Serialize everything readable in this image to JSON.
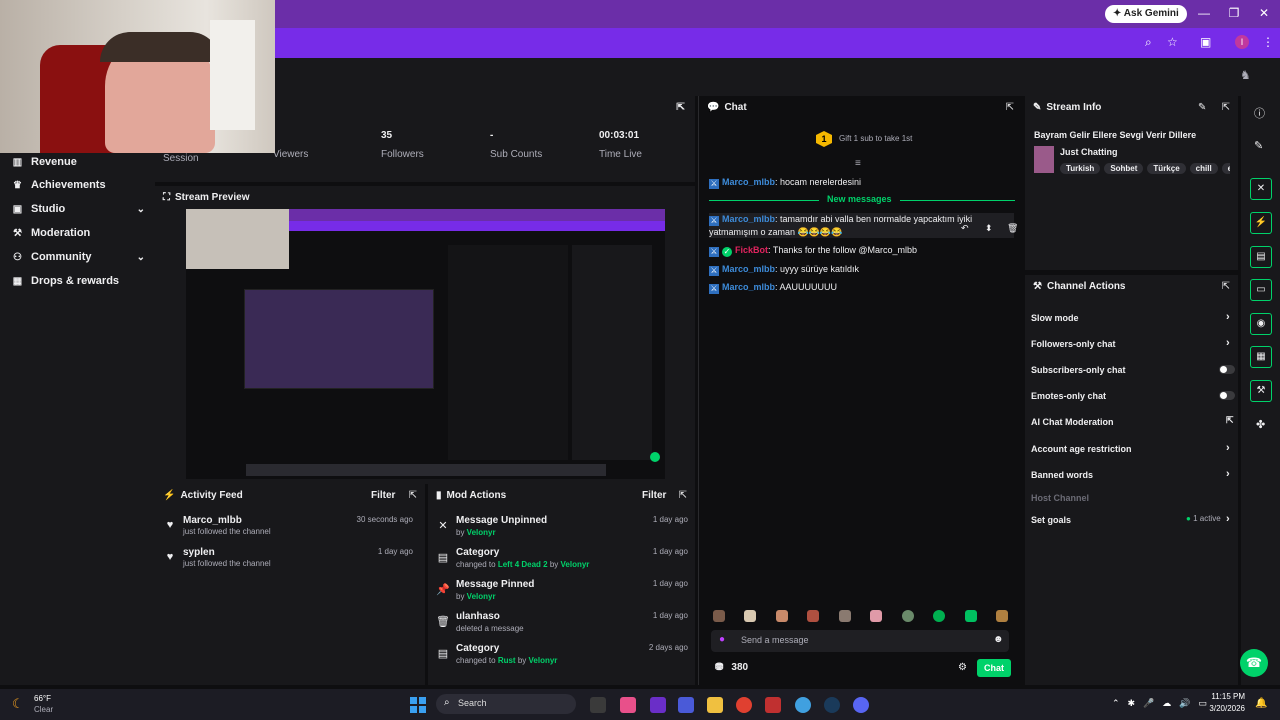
{
  "browser": {
    "gemini_label": "Ask Gemini",
    "profile_initial": "I"
  },
  "sidebar": {
    "items": [
      {
        "label": "Revenue",
        "icon": "bar-chart-icon",
        "glyph": "▥",
        "chevron": false
      },
      {
        "label": "Achievements",
        "icon": "trophy-icon",
        "glyph": "🏆",
        "chevron": false
      },
      {
        "label": "Studio",
        "icon": "studio-icon",
        "glyph": "▣",
        "chevron": true
      },
      {
        "label": "Moderation",
        "icon": "wrench-icon",
        "glyph": "🔧",
        "chevron": false
      },
      {
        "label": "Community",
        "icon": "community-icon",
        "glyph": "👥",
        "chevron": true
      },
      {
        "label": "Drops & rewards",
        "icon": "gift-icon",
        "glyph": "🎁",
        "chevron": false
      }
    ]
  },
  "stats": [
    {
      "value": "",
      "label": "Session"
    },
    {
      "value": "",
      "label": "Viewers"
    },
    {
      "value": "35",
      "label": "Followers"
    },
    {
      "value": "-",
      "label": "Sub Counts"
    },
    {
      "value": "00:03:01",
      "label": "Time Live"
    }
  ],
  "stream_preview": {
    "title": "Stream Preview"
  },
  "activity_feed": {
    "title": "Activity Feed",
    "filter_label": "Filter",
    "items": [
      {
        "name": "Marco_mlbb",
        "action": "just followed the channel",
        "time": "30 seconds ago"
      },
      {
        "name": "syplen",
        "action": "just followed the channel",
        "time": "1 day ago"
      }
    ]
  },
  "mod_actions": {
    "title": "Mod Actions",
    "filter_label": "Filter",
    "items": [
      {
        "icon": "unpin-icon",
        "glyph": "✕",
        "name": "Message Unpinned",
        "pre": "by ",
        "hl": "Velonyr",
        "mid": "",
        "hl2": "",
        "time": "1 day ago"
      },
      {
        "icon": "category-icon",
        "glyph": "▤",
        "name": "Category",
        "pre": "changed to ",
        "hl": "Left 4 Dead 2",
        "mid": " by ",
        "hl2": "Velonyr",
        "time": "1 day ago"
      },
      {
        "icon": "pin-icon",
        "glyph": "📌",
        "name": "Message Pinned",
        "pre": "by ",
        "hl": "Velonyr",
        "mid": "",
        "hl2": "",
        "time": "1 day ago"
      },
      {
        "icon": "trash-icon",
        "glyph": "🗑",
        "name": "ulanhaso",
        "pre": "deleted a message",
        "hl": "",
        "mid": "",
        "hl2": "",
        "time": "1 day ago"
      },
      {
        "icon": "category-icon",
        "glyph": "▤",
        "name": "Category",
        "pre": "changed to ",
        "hl": "Rust",
        "mid": " by ",
        "hl2": "Velonyr",
        "time": "2 days ago"
      }
    ]
  },
  "chat": {
    "title": "Chat",
    "gift_label": "Gift 1 sub to take 1st",
    "gift_rank": "1",
    "new_messages_label": "New messages",
    "messages": [
      {
        "user": "Marco_mlbb",
        "color": "#3d8bd9",
        "text": ": hocam nerelerdesini"
      },
      {
        "user": "Marco_mlbb",
        "color": "#3d8bd9",
        "text": ": tamamdır abi valla ben normalde yapcaktım iyiki yatmamışım o zaman 😂😂😂😂"
      },
      {
        "user": "FickBot",
        "color": "#e0245e",
        "text": ": Thanks for the follow @Marco_mlbb"
      },
      {
        "user": "Marco_mlbb",
        "color": "#3d8bd9",
        "text": ": uyyy sürüye katıldık"
      },
      {
        "user": "Marco_mlbb",
        "color": "#3d8bd9",
        "text": ": AAUUUUUUU"
      }
    ],
    "input_placeholder": "Send a message",
    "points": "380",
    "chat_button": "Chat"
  },
  "stream_info": {
    "title": "Stream Info",
    "stream_title": "Bayram Gelir Ellere Sevgi Verir Dillere",
    "category": "Just Chatting",
    "tags": [
      "Turkish",
      "Sohbet",
      "Türkçe",
      "chill",
      "el"
    ]
  },
  "channel_actions": {
    "title": "Channel Actions",
    "rows": [
      {
        "label": "Slow mode",
        "control": "chevron"
      },
      {
        "label": "Followers-only chat",
        "control": "chevron"
      },
      {
        "label": "Subscribers-only chat",
        "control": "toggle"
      },
      {
        "label": "Emotes-only chat",
        "control": "toggle"
      },
      {
        "label": "AI Chat Moderation",
        "control": "external"
      },
      {
        "label": "Account age restriction",
        "control": "chevron"
      },
      {
        "label": "Banned words",
        "control": "chevron"
      },
      {
        "label": "Host Channel",
        "control": "none"
      },
      {
        "label": "Set goals",
        "control": "chevron",
        "status": "1 active"
      }
    ]
  },
  "taskbar": {
    "weather_temp": "66°F",
    "weather_desc": "Clear",
    "search_label": "Search",
    "time": "11:15 PM",
    "date": "3/20/2026"
  },
  "colors": {
    "accent": "#00d26a",
    "brand": "#772ce8",
    "panel": "#18181b",
    "bg": "#0e0e10"
  }
}
